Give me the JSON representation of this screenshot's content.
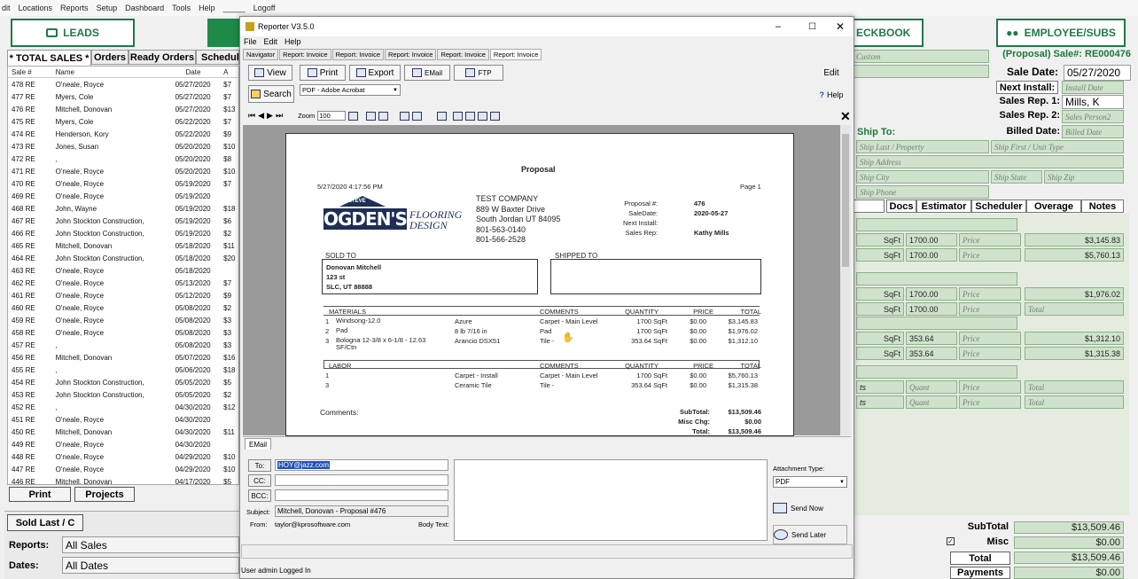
{
  "menubar": {
    "items": [
      "dit",
      "Locations",
      "Reports",
      "Setup",
      "Dashboard",
      "Tools",
      "Help",
      "_____",
      "Logoff"
    ]
  },
  "main_buttons": {
    "leads": "LEADS",
    "checkbook": "ECKBOOK",
    "employee_subs": "EMPLOYEE/SUBS"
  },
  "left_tabs": [
    "* TOTAL SALES *",
    "Orders",
    "Ready Orders",
    "Schedule"
  ],
  "left_grid": {
    "headers": [
      "Sale #",
      "Name",
      "Date",
      "A"
    ],
    "rows": [
      [
        "478 RE",
        "O'neale, Royce",
        "05/27/2020",
        "$7"
      ],
      [
        "477 RE",
        "Myers, Cole",
        "05/27/2020",
        "$7"
      ],
      [
        "476 RE",
        "Mitchell, Donovan",
        "05/27/2020",
        "$13"
      ],
      [
        "475 RE",
        "Myers, Cole",
        "05/22/2020",
        "$7"
      ],
      [
        "474 RE",
        "Henderson, Kory",
        "05/22/2020",
        "$9"
      ],
      [
        "473 RE",
        "Jones, Susan",
        "05/20/2020",
        "$10"
      ],
      [
        "472 RE",
        ",",
        "05/20/2020",
        "$8"
      ],
      [
        "471 RE",
        "O'neale, Royce",
        "05/20/2020",
        "$10"
      ],
      [
        "470 RE",
        "O'neale, Royce",
        "05/19/2020",
        "$7"
      ],
      [
        "469 RE",
        "O'neale, Royce",
        "05/19/2020",
        ""
      ],
      [
        "468 RE",
        "John, Wayne",
        "05/19/2020",
        "$18"
      ],
      [
        "467 RE",
        "John Stockton Construction,",
        "05/19/2020",
        "$6"
      ],
      [
        "466 RE",
        "John Stockton Construction,",
        "05/19/2020",
        "$2"
      ],
      [
        "465 RE",
        "Mitchell, Donovan",
        "05/18/2020",
        "$11"
      ],
      [
        "464 RE",
        "John Stockton Construction,",
        "05/18/2020",
        "$20"
      ],
      [
        "463 RE",
        "O'neale, Royce",
        "05/18/2020",
        ""
      ],
      [
        "462 RE",
        "O'neale, Royce",
        "05/13/2020",
        "$7"
      ],
      [
        "461 RE",
        "O'neale, Royce",
        "05/12/2020",
        "$9"
      ],
      [
        "460 RE",
        "O'neale, Royce",
        "05/08/2020",
        "$2"
      ],
      [
        "459 RE",
        "O'neale, Royce",
        "05/08/2020",
        "$3"
      ],
      [
        "458 RE",
        "O'neale, Royce",
        "05/08/2020",
        "$3"
      ],
      [
        "457 RE",
        ",",
        "05/08/2020",
        "$3"
      ],
      [
        "456 RE",
        "Mitchell, Donovan",
        "05/07/2020",
        "$16"
      ],
      [
        "455 RE",
        ",",
        "05/06/2020",
        "$18"
      ],
      [
        "454 RE",
        "John Stockton Construction,",
        "05/05/2020",
        "$5"
      ],
      [
        "453 RE",
        "John Stockton Construction,",
        "05/05/2020",
        "$2"
      ],
      [
        "452 RE",
        ",",
        "04/30/2020",
        "$12"
      ],
      [
        "451 RE",
        "O'neale, Royce",
        "04/30/2020",
        ""
      ],
      [
        "450 RE",
        "Mitchell, Donovan",
        "04/30/2020",
        "$11"
      ],
      [
        "449 RE",
        "O'neale, Royce",
        "04/30/2020",
        ""
      ],
      [
        "448 RE",
        "O'neale, Royce",
        "04/29/2020",
        "$10"
      ],
      [
        "447 RE",
        "O'neale, Royce",
        "04/29/2020",
        "$10"
      ],
      [
        "446 RE",
        "Mitchell, Donovan",
        "04/17/2020",
        "$5"
      ]
    ]
  },
  "left_bottom": {
    "print": "Print",
    "projects": "Projects",
    "sold_last": "Sold Last / C",
    "reports_label": "Reports:",
    "reports_value": "All Sales",
    "dates_label": "Dates:",
    "dates_value": "All Dates"
  },
  "right": {
    "custom": "Custom",
    "sale_id": "(Proposal) Sale#: RE000476",
    "sale_date_label": "Sale Date:",
    "sale_date": "05/27/2020",
    "next_install_label": "Next Install:",
    "next_install": "Install Date",
    "sales_rep1_label": "Sales Rep. 1:",
    "sales_rep1": "Mills, K",
    "sales_rep2_label": "Sales Rep. 2:",
    "sales_rep2": "Sales Person2",
    "billed_date_label": "Billed Date:",
    "billed_date": "Billed Date",
    "ship_to": "Ship To:",
    "ship_last": "Ship Last / Property",
    "ship_first": "Ship First / Unit Type",
    "ship_address": "Ship Address",
    "ship_city": "Ship City",
    "ship_state": "Ship State",
    "ship_zip": "Ship Zip",
    "ship_phone": "Ship Phone",
    "tabs": [
      "Docs",
      "Estimator",
      "Scheduler",
      "Overage",
      "Notes"
    ],
    "lines": [
      {
        "unit": "SqFt",
        "qty": "1700.00",
        "price": "Price",
        "total": "$3,145.83"
      },
      {
        "unit": "SqFt",
        "qty": "1700.00",
        "price": "Price",
        "total": "$5,760.13"
      },
      {
        "unit": "SqFt",
        "qty": "1700.00",
        "price": "Price",
        "total": "$1,976.02"
      },
      {
        "unit": "SqFt",
        "qty": "1700.00",
        "price": "Price",
        "total": "Total"
      },
      {
        "unit": "SqFt",
        "qty": "353.64",
        "price": "Price",
        "total": "$1,312.10"
      },
      {
        "unit": "SqFt",
        "qty": "353.64",
        "price": "Price",
        "total": "$1,315.38"
      },
      {
        "unit": "ts",
        "qty": "Quant",
        "price": "Price",
        "total": "Total"
      },
      {
        "unit": "ts",
        "qty": "Quant",
        "price": "Price",
        "total": "Total"
      }
    ],
    "subtotal_label": "SubTotal",
    "subtotal": "$13,509.46",
    "misc_label": "Misc",
    "misc": "$0.00",
    "total_label": "Total",
    "total": "$13,509.46",
    "payments_label": "Payments",
    "payments": "$0.00"
  },
  "reporter": {
    "title": "Reporter V3.5.0",
    "menu": [
      "File",
      "Edit",
      "Help"
    ],
    "doc_tabs": [
      "Navigator",
      "Report: Invoice",
      "Report: Invoice",
      "Report: Invoice",
      "Report: Invoice",
      "Report: Invoice"
    ],
    "toolbar": {
      "view": "View",
      "print": "Print",
      "export": "Export",
      "email": "EMail",
      "ftp": "FTP",
      "edit": "Edit",
      "help": "Help",
      "search": "Search",
      "format": "PDF - Adobe Acrobat",
      "zoom_label": "Zoom",
      "zoom": "100"
    },
    "status": "User admin Logged In"
  },
  "document": {
    "title": "Proposal",
    "datetime": "5/27/2020 4:17:56 PM",
    "page": "Page 1",
    "logo": {
      "small": "STEVE",
      "big": "OGDEN'S",
      "sub1": "FLOORING",
      "sub2": "DESIGN"
    },
    "company": [
      "TEST COMPANY",
      "889 W Baxter Drive",
      "South Jordan UT 84095",
      "801-563-0140",
      "801-566-2528"
    ],
    "meta": [
      {
        "k": "Proposal #:",
        "v": "476"
      },
      {
        "k": "SaleDate:",
        "v": "2020-05-27"
      },
      {
        "k": "Next Install:",
        "v": ""
      },
      {
        "k": "Sales Rep:",
        "v": "Kathy Mills"
      }
    ],
    "sold_to_label": "SOLD TO",
    "shipped_to_label": "SHIPPED TO",
    "sold_to": [
      "Donovan Mitchell",
      "123 st",
      "SLC, UT 88888"
    ],
    "mat_headers": [
      "MATERIALS",
      "COMMENTS",
      "QUANTITY",
      "PRICE",
      "TOTAL"
    ],
    "materials": [
      {
        "n": "1",
        "item": "Windsong-12.0",
        "color": "Azure",
        "comment": "Carpet - Main Level",
        "qty": "1700 SqFt",
        "price": "$0.00",
        "total": "$3,145.83"
      },
      {
        "n": "2",
        "item": "Pad",
        "color": "8 lb 7/16 in",
        "comment": "Pad",
        "qty": "1700 SqFt",
        "price": "$0.00",
        "total": "$1,976.02"
      },
      {
        "n": "3",
        "item": "Bologna 12-3/8 x 6-1/8 - 12.63 SF/Ctn",
        "color": "Arancio DSX51",
        "comment": "Tile -",
        "qty": "353.64 SqFt",
        "price": "$0.00",
        "total": "$1,312.10"
      }
    ],
    "lab_headers": [
      "LABOR",
      "COMMENTS",
      "QUANTITY",
      "PRICE",
      "TOTAL"
    ],
    "labor": [
      {
        "n": "1",
        "item": "Carpet - Install",
        "comment": "Carpet - Main Level",
        "qty": "1700 SqFt",
        "price": "$0.00",
        "total": "$5,760.13"
      },
      {
        "n": "3",
        "item": "Ceramic Tile",
        "comment": "Tile -",
        "qty": "353.64 SqFt",
        "price": "$0.00",
        "total": "$1,315.38"
      }
    ],
    "comments_label": "Comments:",
    "totals": [
      {
        "k": "SubTotal:",
        "v": "$13,509.46"
      },
      {
        "k": "Misc Chg:",
        "v": "$0.00"
      },
      {
        "k": "Total:",
        "v": "$13,509.46"
      }
    ]
  },
  "email": {
    "tab": "EMail",
    "to_label": "To:",
    "to": "HOY@jazz.com",
    "cc_label": "CC:",
    "bcc_label": "BCC:",
    "subject_label": "Subject:",
    "subject": "Mitchell, Donovan - Proposal #476",
    "from_label": "From:",
    "from": "taylor@kprosoftware.com",
    "body_label": "Body Text:",
    "attachment_label": "Attachment Type:",
    "attachment": "PDF",
    "send_now": "Send Now",
    "send_later": "Send Later"
  }
}
